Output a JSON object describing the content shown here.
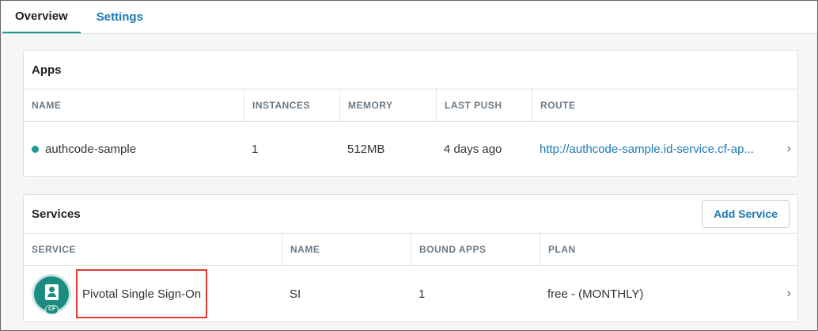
{
  "tabs": [
    {
      "label": "Overview",
      "active": true
    },
    {
      "label": "Settings",
      "active": false
    }
  ],
  "apps": {
    "title": "Apps",
    "columns": [
      "NAME",
      "INSTANCES",
      "MEMORY",
      "LAST PUSH",
      "ROUTE"
    ],
    "rows": [
      {
        "name": "authcode-sample",
        "status_color": "#1d9a8f",
        "instances": "1",
        "memory": "512MB",
        "last_push": "4 days ago",
        "route": "http://authcode-sample.id-service.cf-ap..."
      }
    ]
  },
  "services": {
    "title": "Services",
    "add_button": "Add Service",
    "columns": [
      "SERVICE",
      "NAME",
      "BOUND APPS",
      "PLAN"
    ],
    "rows": [
      {
        "service": "Pivotal Single Sign-On",
        "icon_badge": "CF",
        "name": "SI",
        "bound_apps": "1",
        "plan": "free - (MONTHLY)"
      }
    ]
  },
  "icons": {
    "chevron": "chevron-right-icon",
    "status": "status-dot-icon",
    "service": "sso-service-icon"
  },
  "colors": {
    "accent": "#1d9a8f",
    "link": "#1b78b3",
    "highlight": "#e03a31"
  }
}
